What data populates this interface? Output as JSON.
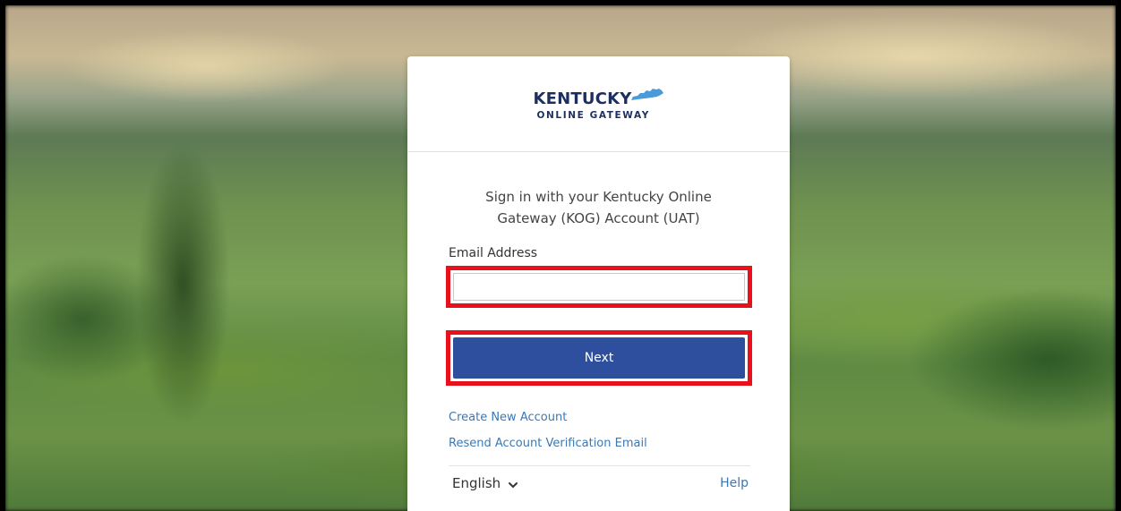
{
  "logo": {
    "title": "KENTUCKY",
    "subtitle": "ONLINE GATEWAY",
    "icon": "kentucky-state-icon",
    "color": "#1d2f5e",
    "accent": "#4a9bd9"
  },
  "form": {
    "heading_line1": "Sign in with your Kentucky Online",
    "heading_line2": "Gateway (KOG) Account (UAT)",
    "email_label": "Email Address",
    "email_value": "",
    "email_placeholder": "",
    "next_label": "Next"
  },
  "links": {
    "create_account": "Create New Account",
    "resend_verification": "Resend Account Verification Email"
  },
  "footer": {
    "language": "English",
    "help": "Help"
  },
  "colors": {
    "button": "#2e4f9e",
    "link": "#3b78b4",
    "highlight": "#e8101a"
  }
}
